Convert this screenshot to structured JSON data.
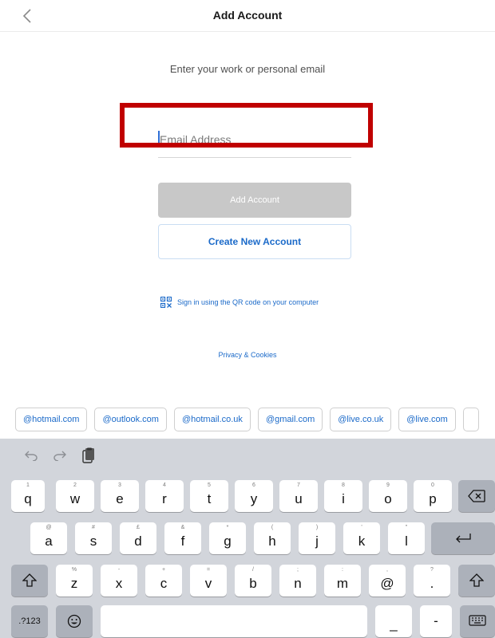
{
  "header": {
    "title": "Add Account"
  },
  "prompt": "Enter your work or personal email",
  "email": {
    "placeholder": "Email Address",
    "value": ""
  },
  "buttons": {
    "add_account": "Add Account",
    "create_account": "Create New Account"
  },
  "qr_link": "Sign in using the QR code on your computer",
  "privacy_link": "Privacy & Cookies",
  "domain_suggestions": [
    "@hotmail.com",
    "@outlook.com",
    "@hotmail.co.uk",
    "@gmail.com",
    "@live.co.uk",
    "@live.com"
  ],
  "keyboard": {
    "row1": [
      {
        "main": "q",
        "sub": "1"
      },
      {
        "main": "w",
        "sub": "2"
      },
      {
        "main": "e",
        "sub": "3"
      },
      {
        "main": "r",
        "sub": "4"
      },
      {
        "main": "t",
        "sub": "5"
      },
      {
        "main": "y",
        "sub": "6"
      },
      {
        "main": "u",
        "sub": "7"
      },
      {
        "main": "i",
        "sub": "8"
      },
      {
        "main": "o",
        "sub": "9"
      },
      {
        "main": "p",
        "sub": "0"
      }
    ],
    "row2": [
      {
        "main": "a",
        "sub": "@"
      },
      {
        "main": "s",
        "sub": "#"
      },
      {
        "main": "d",
        "sub": "£"
      },
      {
        "main": "f",
        "sub": "&"
      },
      {
        "main": "g",
        "sub": "*"
      },
      {
        "main": "h",
        "sub": "("
      },
      {
        "main": "j",
        "sub": ")"
      },
      {
        "main": "k",
        "sub": "'"
      },
      {
        "main": "l",
        "sub": "\""
      }
    ],
    "row3": [
      {
        "main": "z",
        "sub": "%"
      },
      {
        "main": "x",
        "sub": "-"
      },
      {
        "main": "c",
        "sub": "+"
      },
      {
        "main": "v",
        "sub": "="
      },
      {
        "main": "b",
        "sub": "/"
      },
      {
        "main": "n",
        "sub": ";"
      },
      {
        "main": "m",
        "sub": ":"
      },
      {
        "main": "@",
        "sub": ","
      },
      {
        "main": ".",
        "sub": "?"
      }
    ],
    "numbers_key": ".?123",
    "underscore_key": "_",
    "dash_key": "-",
    "icons": {
      "back": "chevron-left-icon",
      "qr": "qr-code-icon",
      "undo": "undo-icon",
      "redo": "redo-icon",
      "paste": "paste-icon",
      "backspace": "backspace-icon",
      "return": "return-icon",
      "shift": "shift-icon",
      "emoji": "emoji-icon",
      "hide_keyboard": "keyboard-icon"
    }
  },
  "colors": {
    "accent": "#1b6ac9",
    "disabled_button": "#c8c8c8",
    "highlight": "#c00000",
    "keyboard_bg": "#d2d5db",
    "key_dark": "#acb1ba"
  }
}
